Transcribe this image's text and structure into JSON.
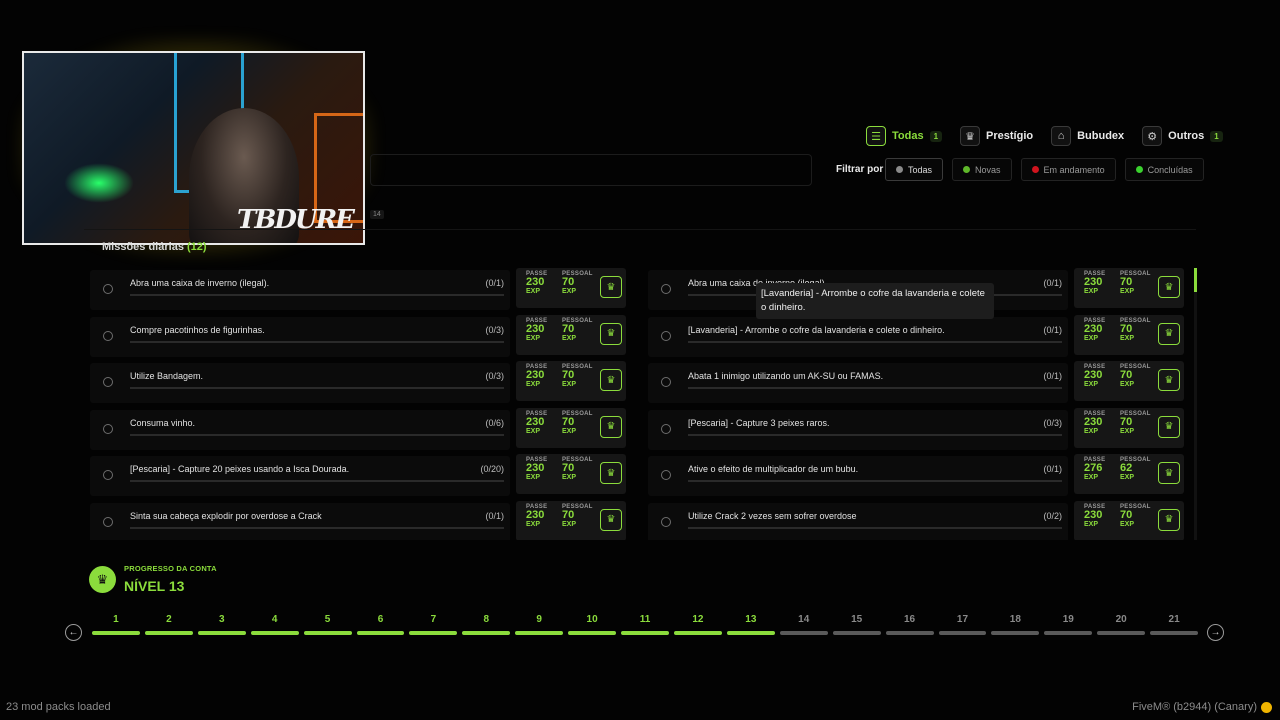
{
  "tabs": [
    {
      "label": "Todas",
      "icon": "checklist-icon",
      "badge": "1",
      "active": true
    },
    {
      "label": "Prestígio",
      "icon": "crown-icon",
      "badge": "",
      "active": false
    },
    {
      "label": "Bubudex",
      "icon": "bell-icon",
      "badge": "",
      "active": false
    },
    {
      "label": "Outros",
      "icon": "share-icon",
      "badge": "1",
      "active": false
    }
  ],
  "filter": {
    "label": "Filtrar por",
    "options": [
      {
        "label": "Todas",
        "color": "#8a8a8a",
        "active": true
      },
      {
        "label": "Novas",
        "color": "#5fb82a",
        "active": false
      },
      {
        "label": "Em andamento",
        "color": "#d0141e",
        "active": false
      },
      {
        "label": "Concluídas",
        "color": "#3ad12e",
        "active": false
      }
    ]
  },
  "section": {
    "title": "Missões diárias",
    "count": "(12)",
    "badge": "14"
  },
  "reward_labels": {
    "passe": "PASSE",
    "pessoal": "PESSOAL",
    "unit": "EXP"
  },
  "missions_left": [
    {
      "text": "Abra uma caixa de inverno (ilegal).",
      "progress": "(0/1)",
      "passe": "230",
      "pessoal": "70"
    },
    {
      "text": "Compre pacotinhos de figurinhas.",
      "progress": "(0/3)",
      "passe": "230",
      "pessoal": "70"
    },
    {
      "text": "Utilize Bandagem.",
      "progress": "(0/3)",
      "passe": "230",
      "pessoal": "70"
    },
    {
      "text": "Consuma vinho.",
      "progress": "(0/6)",
      "passe": "230",
      "pessoal": "70"
    },
    {
      "text": "[Pescaria] - Capture 20 peixes usando a Isca Dourada.",
      "progress": "(0/20)",
      "passe": "230",
      "pessoal": "70"
    },
    {
      "text": "Sinta sua cabeça explodir por overdose a Crack",
      "progress": "(0/1)",
      "passe": "230",
      "pessoal": "70"
    }
  ],
  "missions_right": [
    {
      "text": "Abra uma caixa de inverno (ilegal).",
      "progress": "(0/1)",
      "passe": "230",
      "pessoal": "70"
    },
    {
      "text": "[Lavanderia] - Arrombe o cofre da lavanderia e colete o dinheiro.",
      "progress": "(0/1)",
      "passe": "230",
      "pessoal": "70"
    },
    {
      "text": "Abata 1 inimigo utilizando um AK-SU ou FAMAS.",
      "progress": "(0/1)",
      "passe": "230",
      "pessoal": "70"
    },
    {
      "text": "[Pescaria] - Capture 3 peixes raros.",
      "progress": "(0/3)",
      "passe": "230",
      "pessoal": "70"
    },
    {
      "text": "Ative o efeito de multiplicador de um bubu.",
      "progress": "(0/1)",
      "passe": "276",
      "pessoal": "62"
    },
    {
      "text": "Utilize Crack 2 vezes sem sofrer overdose",
      "progress": "(0/2)",
      "passe": "230",
      "pessoal": "70"
    }
  ],
  "tooltip": "[Lavanderia] - Arrombe o cofre da lavanderia e colete o dinheiro.",
  "account": {
    "caption": "PROGRESSO DA CONTA",
    "level_title": "NÍVEL 13",
    "current_level": 13,
    "levels": [
      "1",
      "2",
      "3",
      "4",
      "5",
      "6",
      "7",
      "8",
      "9",
      "10",
      "11",
      "12",
      "13",
      "14",
      "15",
      "16",
      "17",
      "18",
      "19",
      "20",
      "21"
    ]
  },
  "webcam": {
    "signature": "TBDURE"
  },
  "footer": {
    "left": "23 mod packs loaded",
    "right": "FiveM® (b2944) (Canary)"
  },
  "colors": {
    "accent": "#8bdc3c",
    "inactive": "#5a5a5a"
  }
}
